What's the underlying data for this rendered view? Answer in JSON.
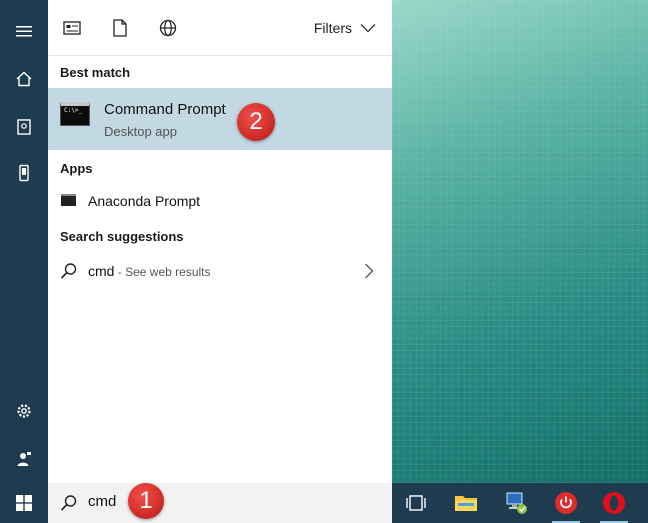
{
  "toolbar": {
    "icons": [
      "apps-filter-icon",
      "documents-filter-icon",
      "web-filter-icon"
    ],
    "filters_label": "Filters"
  },
  "sections": {
    "best_match": "Best match",
    "apps": "Apps",
    "search_suggestions": "Search suggestions"
  },
  "best_match": {
    "title": "Command Prompt",
    "subtitle": "Desktop app",
    "icon_text": "C:\\>_"
  },
  "apps": [
    {
      "label": "Anaconda Prompt"
    }
  ],
  "suggestion": {
    "term": "cmd",
    "suffix": " - See web results"
  },
  "search": {
    "value": "cmd"
  },
  "badges": {
    "one": "1",
    "two": "2"
  },
  "colors": {
    "rail": "#1f3b4f",
    "highlight": "#c2d8e2",
    "badge": "#d22d2a"
  }
}
